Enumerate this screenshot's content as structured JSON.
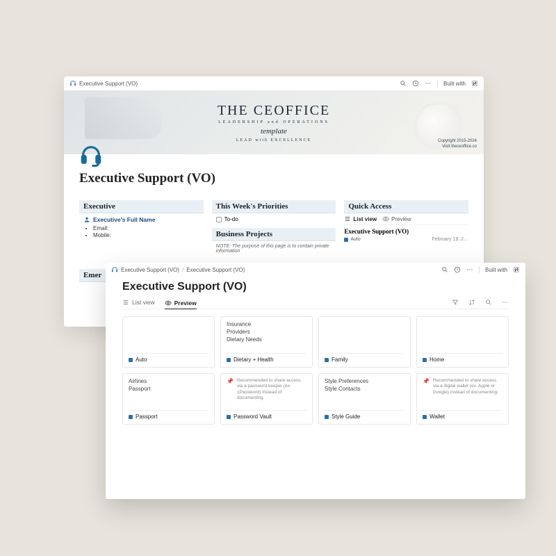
{
  "back": {
    "crumbs": [
      "Executive Support (VO)"
    ],
    "built_with": "Built with",
    "banner": {
      "line1": "THE CEOFFICE",
      "line2": "LEADERSHIP and OPERATIONS",
      "line3": "template",
      "line4": "LEAD with EXCELLENCE",
      "copyright1": "Copyright 2015-2024",
      "copyright2": "Visit theceoffice.co"
    },
    "title": "Executive Support (VO)",
    "col_exec": {
      "header": "Executive",
      "name": "Executive's Full Name",
      "email_label": "Email:",
      "mobile_label": "Mobile:"
    },
    "col_week": {
      "header": "This Week's Priorities",
      "todo": "To-do",
      "biz_header": "Business Projects",
      "biz_note": "NOTE: The purpose of this page is to contain private information"
    },
    "col_quick": {
      "header": "Quick Access",
      "tab_list": "List view",
      "tab_prev": "Preview",
      "sub": "Executive Support (VO)",
      "row_label": "Auto",
      "row_date": "February 19, 2…"
    },
    "emer_header": "Emer"
  },
  "front": {
    "crumbs": [
      "Executive Support (VO)",
      "Executive Support (VO)"
    ],
    "built_with": "Built with",
    "title": "Executive Support (VO)",
    "tab_list": "List view",
    "tab_prev": "Preview",
    "cards": [
      {
        "body": "",
        "label": "Auto"
      },
      {
        "body": "Insurance\nProviders\nDietary Needs",
        "label": "Dietary + Health"
      },
      {
        "body": "",
        "label": "Family"
      },
      {
        "body": "",
        "label": "Home"
      },
      {
        "body": "Airlines\nPassport",
        "label": "Passport"
      },
      {
        "rec": "Recommended to share access via a password keeper (ex. 1Password) instead of documenting.",
        "label": "Password Vault"
      },
      {
        "body": "Style Preferences\nStyle Contacts",
        "label": "Style Guide"
      },
      {
        "rec": "Recommended to share access via a digital wallet (ex. Apple or Google) instead of documenting.",
        "label": "Wallet"
      }
    ]
  }
}
